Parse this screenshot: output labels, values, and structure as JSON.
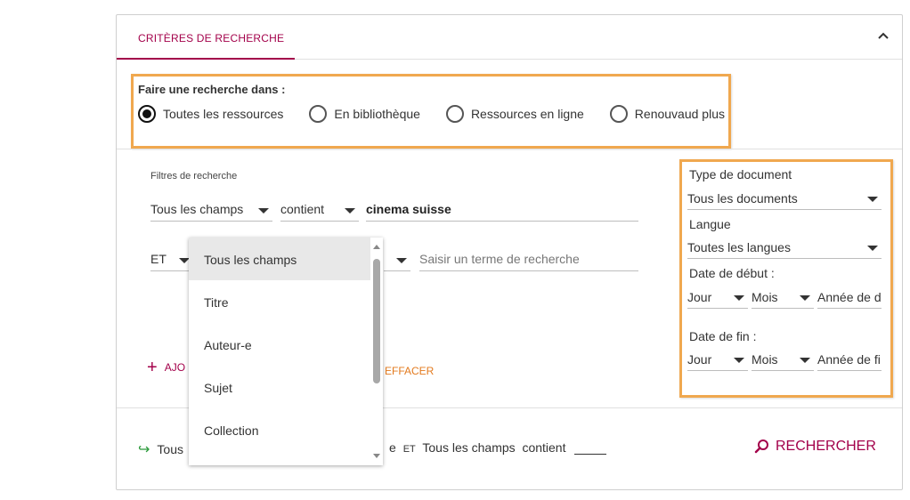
{
  "tab": {
    "label": "CRITÈRES DE RECHERCHE"
  },
  "icons": {
    "collapse": "chevron-up-icon",
    "add": "plus-icon",
    "arrow": "return-arrow-icon",
    "search": "search-icon"
  },
  "colors": {
    "accent": "#a3004a",
    "highlight": "#f0a84f",
    "clear": "#e37a1e",
    "arrow": "#2b9a3a"
  },
  "scope": {
    "label": "Faire une recherche dans :",
    "options": [
      {
        "label": "Toutes les ressources",
        "selected": true
      },
      {
        "label": "En bibliothèque",
        "selected": false
      },
      {
        "label": "Ressources en ligne",
        "selected": false
      },
      {
        "label": "Renouvaud plus",
        "selected": false
      }
    ]
  },
  "filters": {
    "label": "Filtres de recherche",
    "row1": {
      "field": "Tous les champs",
      "operator": "contient",
      "value": "cinema suisse"
    },
    "row2": {
      "boolean": "ET",
      "value_placeholder": "Saisir un terme de recherche"
    },
    "add_label": "AJO",
    "clear_label": "EFFACER"
  },
  "dropdown": {
    "items": [
      "Tous les champs",
      "Titre",
      "Auteur-e",
      "Sujet",
      "Collection"
    ],
    "selected_index": 0
  },
  "sidebar": {
    "doc_type_label": "Type de document",
    "doc_type_value": "Tous les documents",
    "lang_label": "Langue",
    "lang_value": "Toutes les langues",
    "start_label": "Date de début :",
    "end_label": "Date de fin :",
    "day": "Jour",
    "month": "Mois",
    "start_year_placeholder": "Année de d",
    "end_year_placeholder": "Année de fi"
  },
  "summary": {
    "left": "Tous",
    "right_suffix": "e",
    "op": "ET",
    "field": "Tous les champs",
    "operator": "contient"
  },
  "search_button": {
    "label": "RECHERCHER"
  }
}
